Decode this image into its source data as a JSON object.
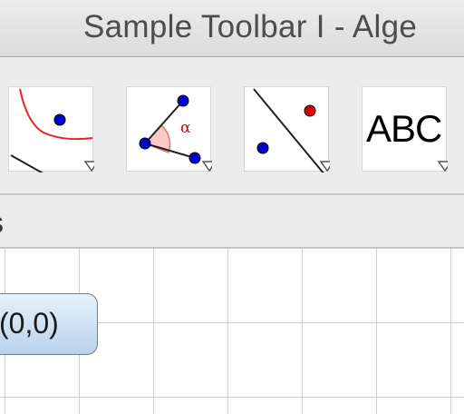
{
  "window": {
    "title": "Sample Toolbar I - Alge"
  },
  "toolbar": {
    "tools": [
      {
        "icon": "conic-with-point-icon"
      },
      {
        "icon": "angle-icon",
        "glyph": "α"
      },
      {
        "icon": "line-and-points-icon"
      },
      {
        "icon": "text-tool-icon",
        "label": "ABC"
      }
    ]
  },
  "graphics_view": {
    "header_title": "s",
    "point_label": "(0,0)"
  },
  "colors": {
    "point_blue": "#0000cc",
    "point_red": "#dd0000",
    "curve_red": "#ee2222"
  }
}
